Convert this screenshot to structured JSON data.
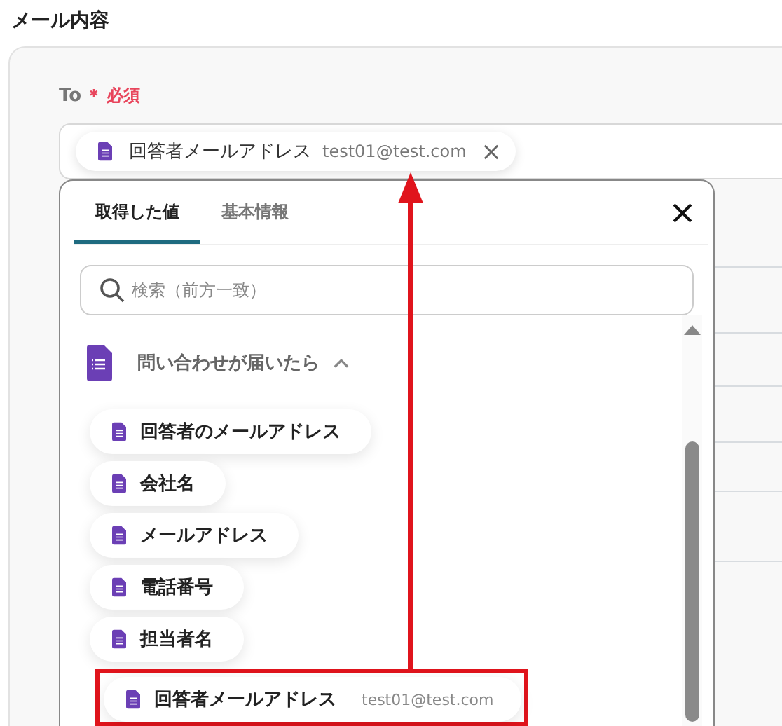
{
  "section_title": "メール内容",
  "field": {
    "label": "To",
    "required_mark": "＊",
    "required_text": "必須",
    "chip": {
      "label": "回答者メールアドレス",
      "value": "test01@test.com"
    }
  },
  "popup": {
    "tabs": [
      {
        "label": "取得した値",
        "selected": true
      },
      {
        "label": "基本情報",
        "selected": false
      }
    ],
    "search": {
      "placeholder": "検索（前方一致）"
    },
    "group": {
      "title": "問い合わせが届いたら",
      "expanded": true
    },
    "items": [
      {
        "label": "回答者のメールアドレス",
        "highlighted": false
      },
      {
        "label": "会社名",
        "highlighted": false
      },
      {
        "label": "メールアドレス",
        "highlighted": false
      },
      {
        "label": "電話番号",
        "highlighted": false
      },
      {
        "label": "担当者名",
        "highlighted": false
      },
      {
        "label": "回答者メールアドレス",
        "value": "test01@test.com",
        "highlighted": true
      }
    ]
  }
}
